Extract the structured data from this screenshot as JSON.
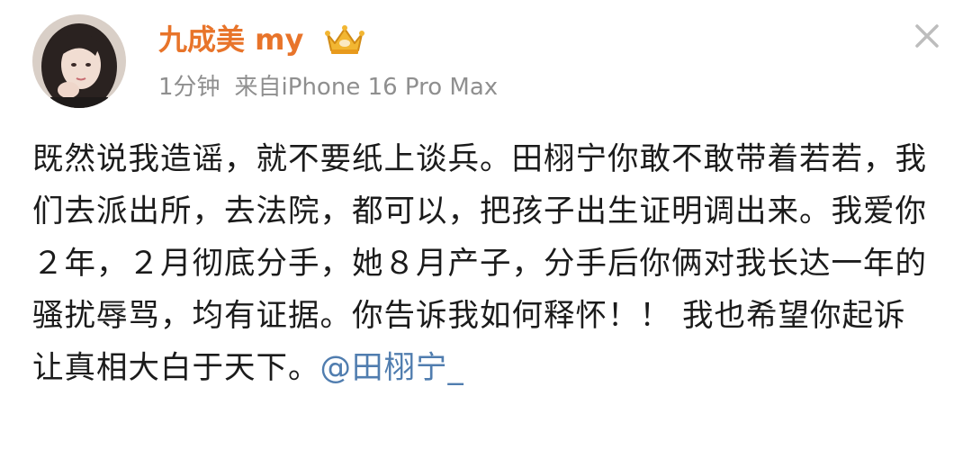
{
  "post": {
    "author": {
      "name": "九成美 my",
      "badge_icon": "crown-icon",
      "avatar": "avatar-photo"
    },
    "time": "1分钟",
    "source": "来自iPhone 16 Pro Max",
    "close_icon": "close-icon",
    "text_before_mention": "既然说我造谣，就不要纸上谈兵。田栩宁你敢不敢带着若若，我们去派出所，去法院，都可以，把孩子出生证明调出来。我爱你２年，２月彻底分手，她８月产子，分手后你俩对我长达一年的骚扰辱骂，均有证据。你告诉我如何释怀！！ 我也希望你起诉 让真相大白于天下。",
    "mention": "@田栩宁_"
  },
  "colors": {
    "username": "#e8742a",
    "meta": "#8f8f8f",
    "text": "#1b1b1b",
    "mention": "#507daf"
  }
}
